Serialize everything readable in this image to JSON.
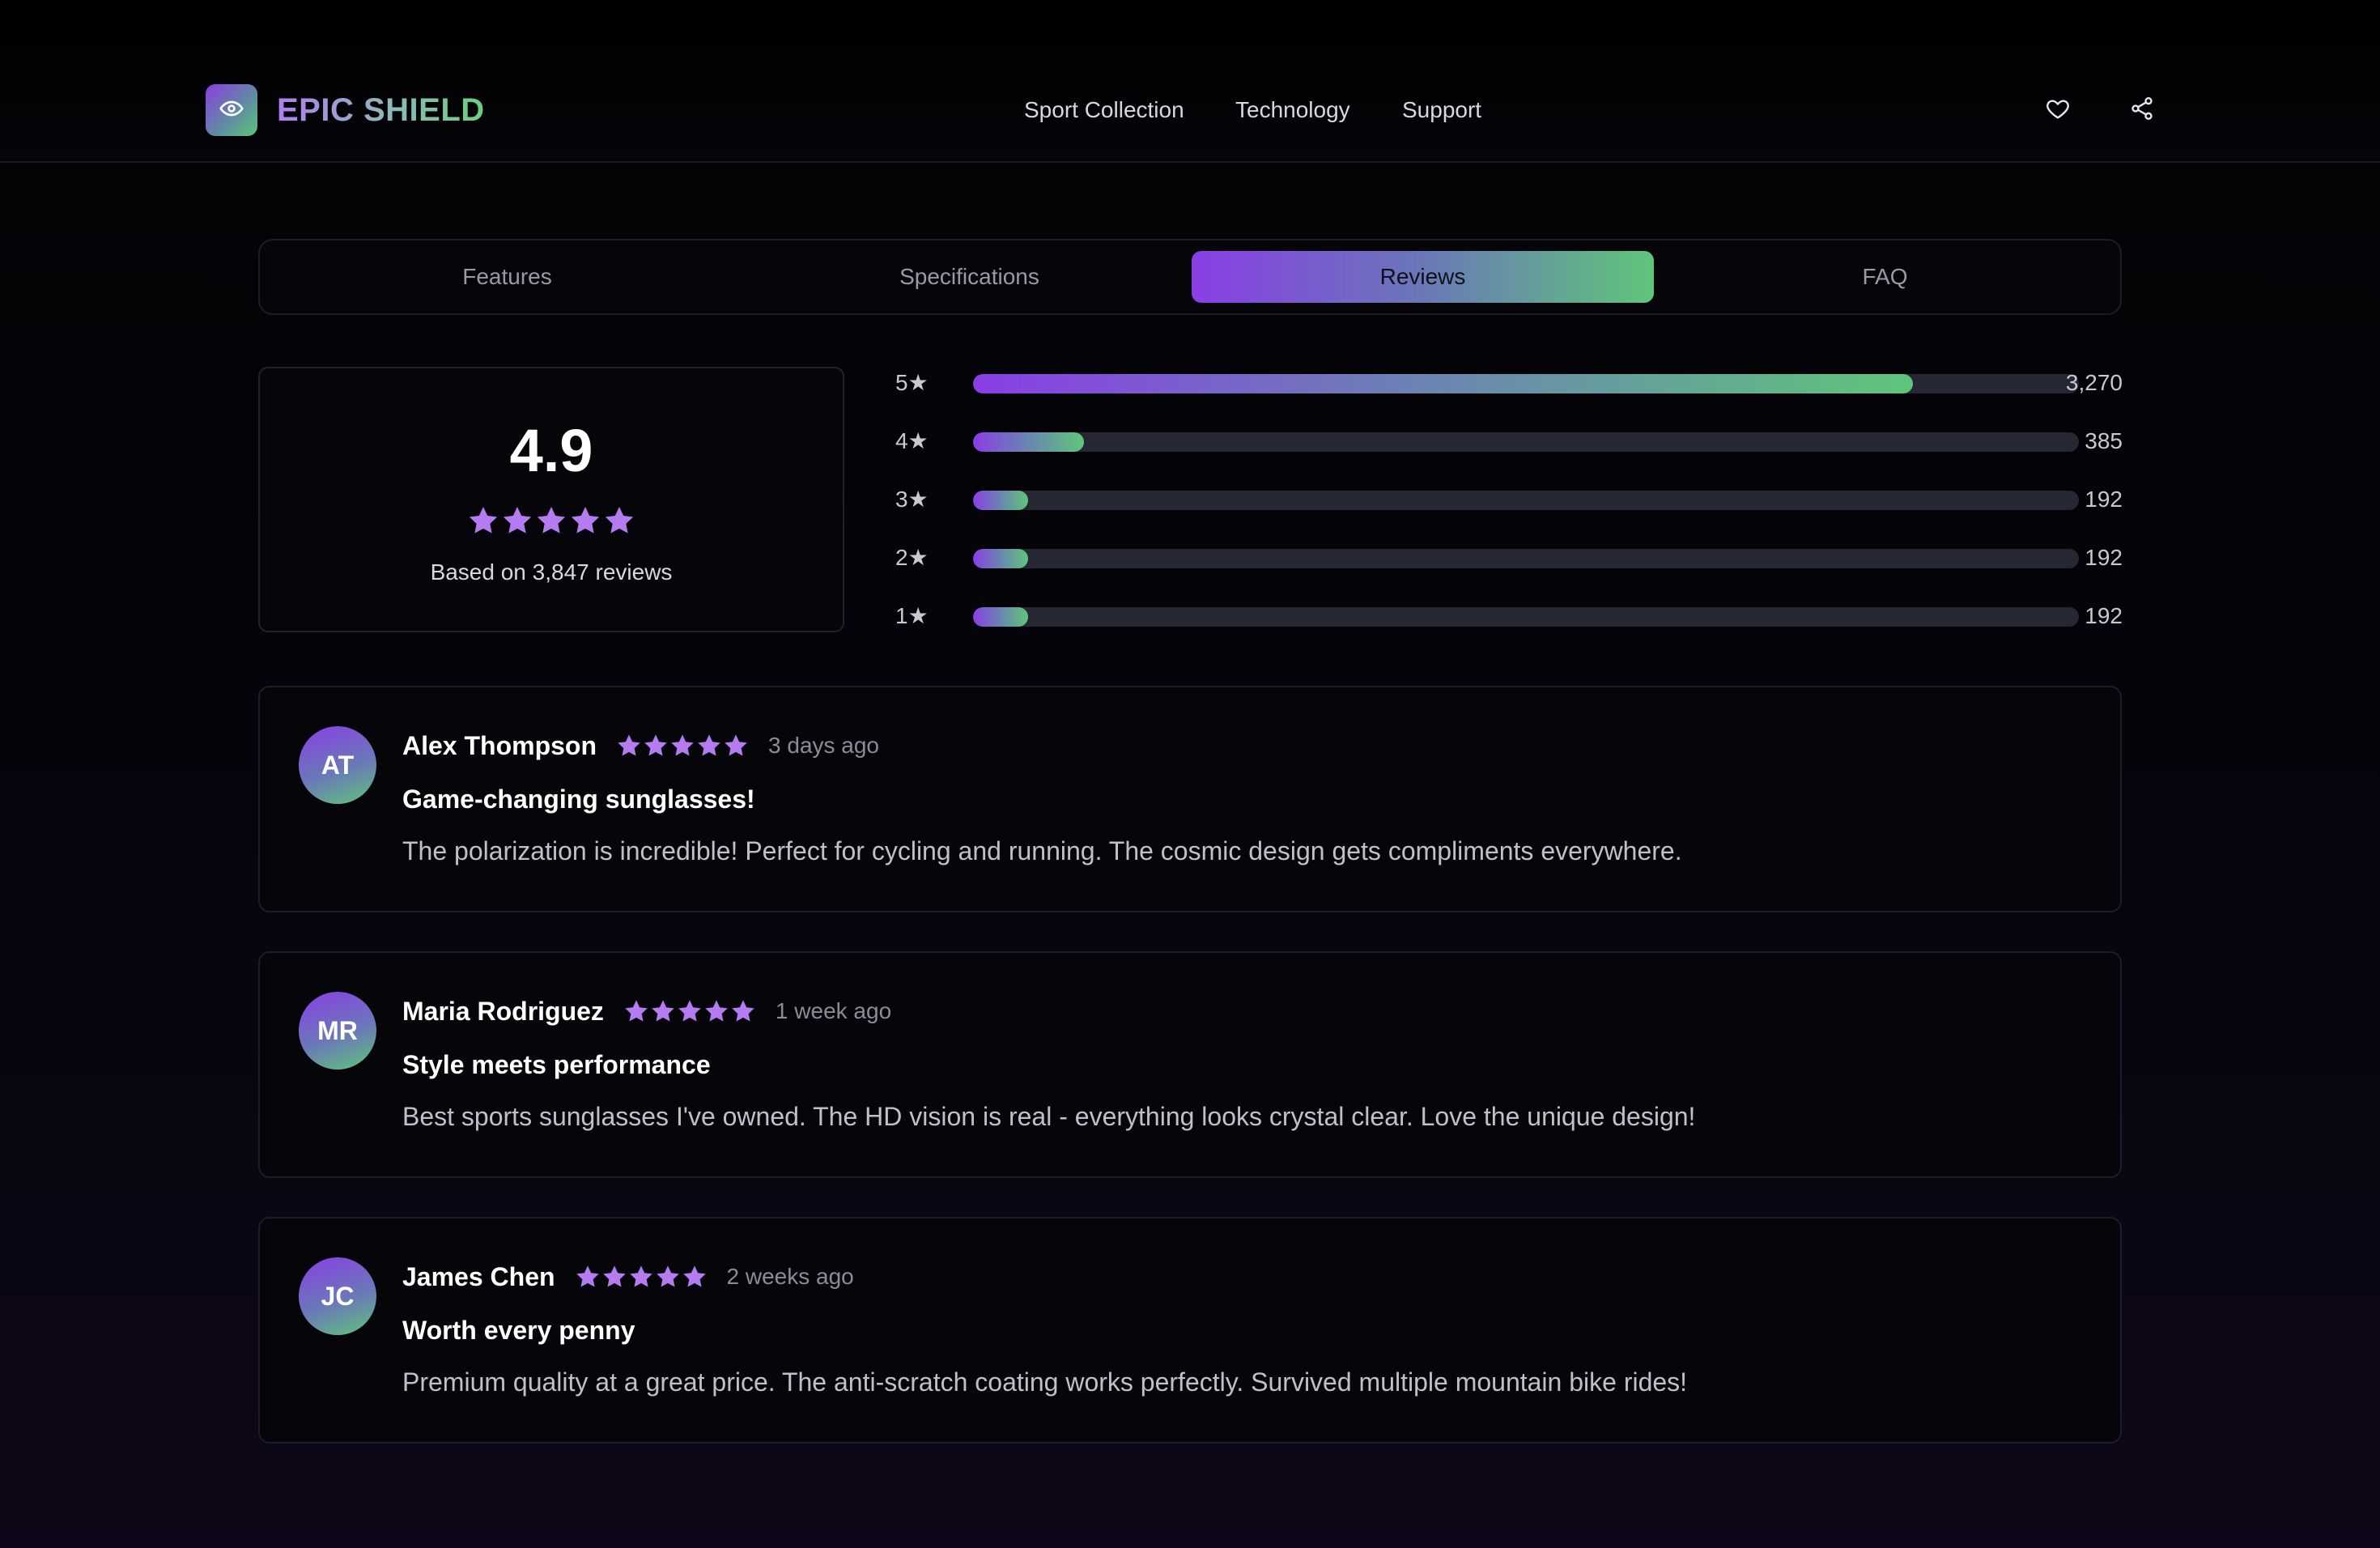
{
  "header": {
    "brand": "EPIC SHIELD",
    "logo_icon": "eye-icon",
    "nav": [
      "Sport Collection",
      "Technology",
      "Support"
    ],
    "actions": [
      "heart-icon",
      "share-icon"
    ]
  },
  "tabs": [
    {
      "label": "Features",
      "active": false
    },
    {
      "label": "Specifications",
      "active": false
    },
    {
      "label": "Reviews",
      "active": true
    },
    {
      "label": "FAQ",
      "active": false
    }
  ],
  "summary": {
    "rating": "4.9",
    "stars": 5,
    "based_on": "Based on 3,847 reviews"
  },
  "distribution": [
    {
      "label": "5★",
      "fraction": 0.85,
      "count": "3,270"
    },
    {
      "label": "4★",
      "fraction": 0.1,
      "count": "385"
    },
    {
      "label": "3★",
      "fraction": 0.05,
      "count": "192"
    },
    {
      "label": "2★",
      "fraction": 0.05,
      "count": "192"
    },
    {
      "label": "1★",
      "fraction": 0.05,
      "count": "192"
    }
  ],
  "reviews": [
    {
      "initials": "AT",
      "name": "Alex Thompson",
      "stars": 5,
      "time": "3 days ago",
      "title": "Game-changing sunglasses!",
      "body": "The polarization is incredible! Perfect for cycling and running. The cosmic design gets compliments everywhere."
    },
    {
      "initials": "MR",
      "name": "Maria Rodriguez",
      "stars": 5,
      "time": "1 week ago",
      "title": "Style meets performance",
      "body": "Best sports sunglasses I've owned. The HD vision is real - everything looks crystal clear. Love the unique design!"
    },
    {
      "initials": "JC",
      "name": "James Chen",
      "stars": 5,
      "time": "2 weeks ago",
      "title": "Worth every penny",
      "body": "Premium quality at a great price. The anti-scratch coating works perfectly. Survived multiple mountain bike rides!"
    }
  ],
  "colors": {
    "accent_purple": "#8a3ee6",
    "accent_green": "#5fc57a",
    "star": "#b57cf2",
    "background": "#05050a"
  }
}
